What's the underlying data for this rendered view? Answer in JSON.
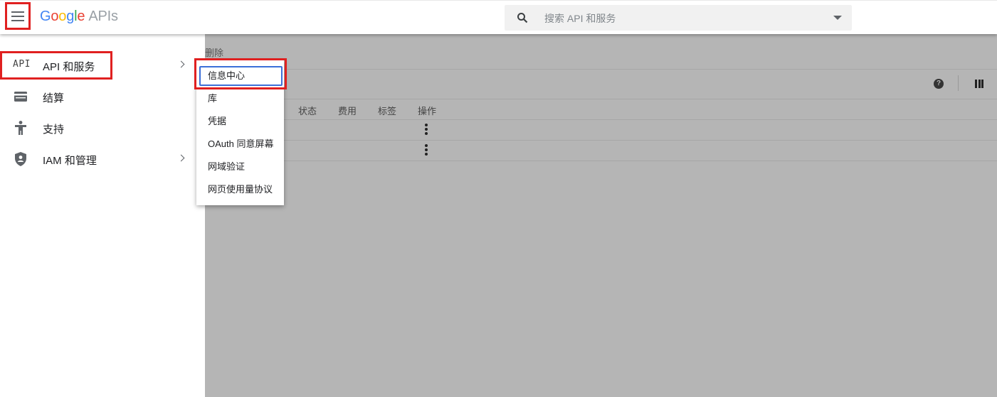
{
  "header": {
    "logo_letters": [
      "G",
      "o",
      "o",
      "g",
      "l",
      "e"
    ],
    "logo_suffix": "APIs",
    "search_placeholder": "搜索 API 和服务"
  },
  "background": {
    "breadcrumb": "删除",
    "table_headers": [
      "状态",
      "费用",
      "标签",
      "操作"
    ],
    "help_glyph": "?"
  },
  "sidenav": {
    "items": [
      {
        "icon": "api-icon",
        "icon_text": "API",
        "label": "API 和服务",
        "has_submenu": true
      },
      {
        "icon": "billing-icon",
        "label": "结算",
        "has_submenu": false
      },
      {
        "icon": "support-icon",
        "label": "支持",
        "has_submenu": false
      },
      {
        "icon": "iam-shield-icon",
        "label": "IAM 和管理",
        "has_submenu": true
      }
    ]
  },
  "submenu": {
    "items": [
      "信息中心",
      "库",
      "凭据",
      "OAuth 同意屏幕",
      "网域验证",
      "网页使用量协议"
    ]
  },
  "colors": {
    "highlight": "#e02020",
    "focus": "#3b6fd8",
    "overlay": "#b5b5b5"
  }
}
